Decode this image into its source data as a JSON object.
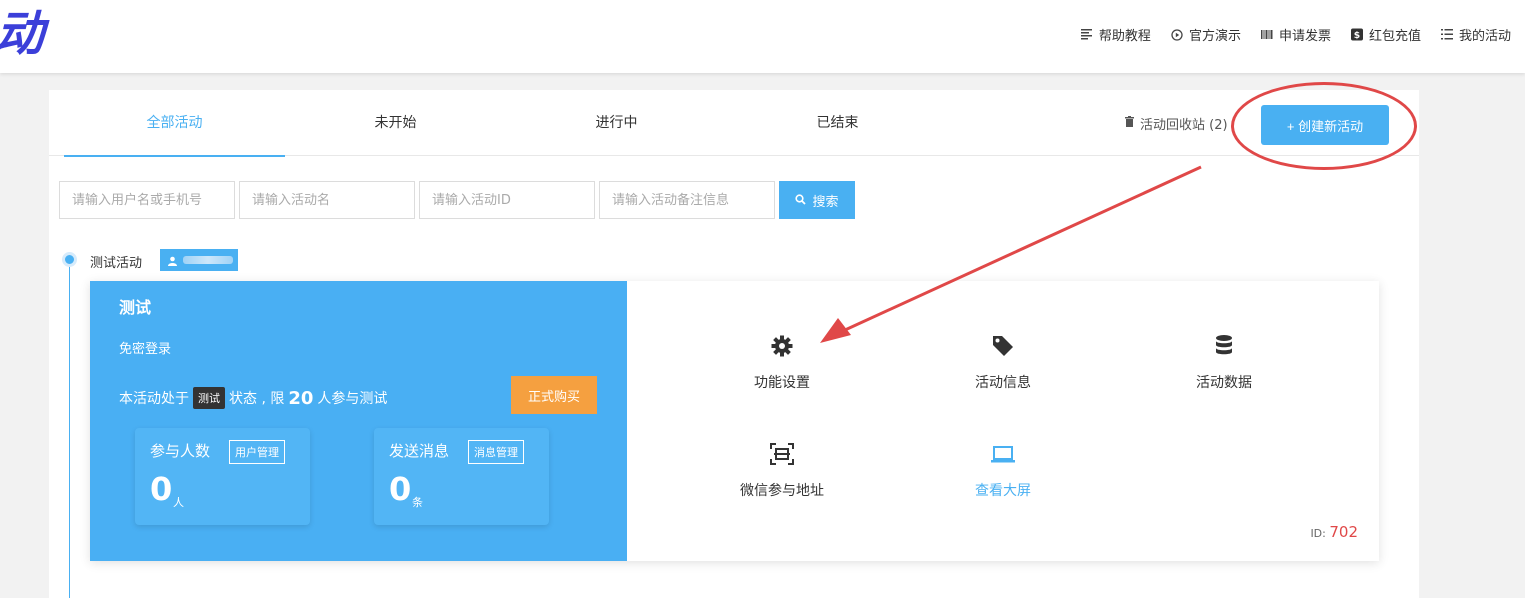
{
  "header": {
    "logo_text": "动",
    "nav": [
      {
        "label": "帮助教程",
        "icon": "doc-lines-icon"
      },
      {
        "label": "官方演示",
        "icon": "play-circle-icon"
      },
      {
        "label": "申请发票",
        "icon": "barcode-icon"
      },
      {
        "label": "红包充值",
        "icon": "dollar-icon"
      },
      {
        "label": "我的活动",
        "icon": "list-icon"
      }
    ]
  },
  "tabs": [
    {
      "label": "全部活动",
      "active": true
    },
    {
      "label": "未开始",
      "active": false
    },
    {
      "label": "进行中",
      "active": false
    },
    {
      "label": "已结束",
      "active": false
    }
  ],
  "recycle_label": "活动回收站 (2)",
  "create_button": "+ 创建新活动",
  "search": {
    "user_placeholder": "请输入用户名或手机号",
    "name_placeholder": "请输入活动名",
    "id_placeholder": "请输入活动ID",
    "note_placeholder": "请输入活动备注信息",
    "button": "搜索"
  },
  "activity": {
    "group_title": "测试活动",
    "name": "测试",
    "login_mode": "免密登录",
    "status_prefix": "本活动处于",
    "status_badge": "测试",
    "status_middle": "状态 , 限",
    "status_limit": "20",
    "status_suffix": "人参与测试",
    "buy_button": "正式购买",
    "participants": {
      "label": "参与人数",
      "manage": "用户管理",
      "value": "0",
      "unit": "人"
    },
    "messages": {
      "label": "发送消息",
      "manage": "消息管理",
      "value": "0",
      "unit": "条"
    },
    "functions": [
      {
        "label": "功能设置",
        "icon": "gear-icon"
      },
      {
        "label": "活动信息",
        "icon": "tag-icon"
      },
      {
        "label": "活动数据",
        "icon": "database-icon"
      },
      {
        "label": "微信参与地址",
        "icon": "scan-icon"
      },
      {
        "label": "查看大屏",
        "icon": "laptop-icon"
      }
    ],
    "id_label": "ID:",
    "id_value": "702"
  },
  "colors": {
    "accent": "#49b0f2",
    "orange": "#f5a040",
    "annotation_red": "#e04848"
  }
}
